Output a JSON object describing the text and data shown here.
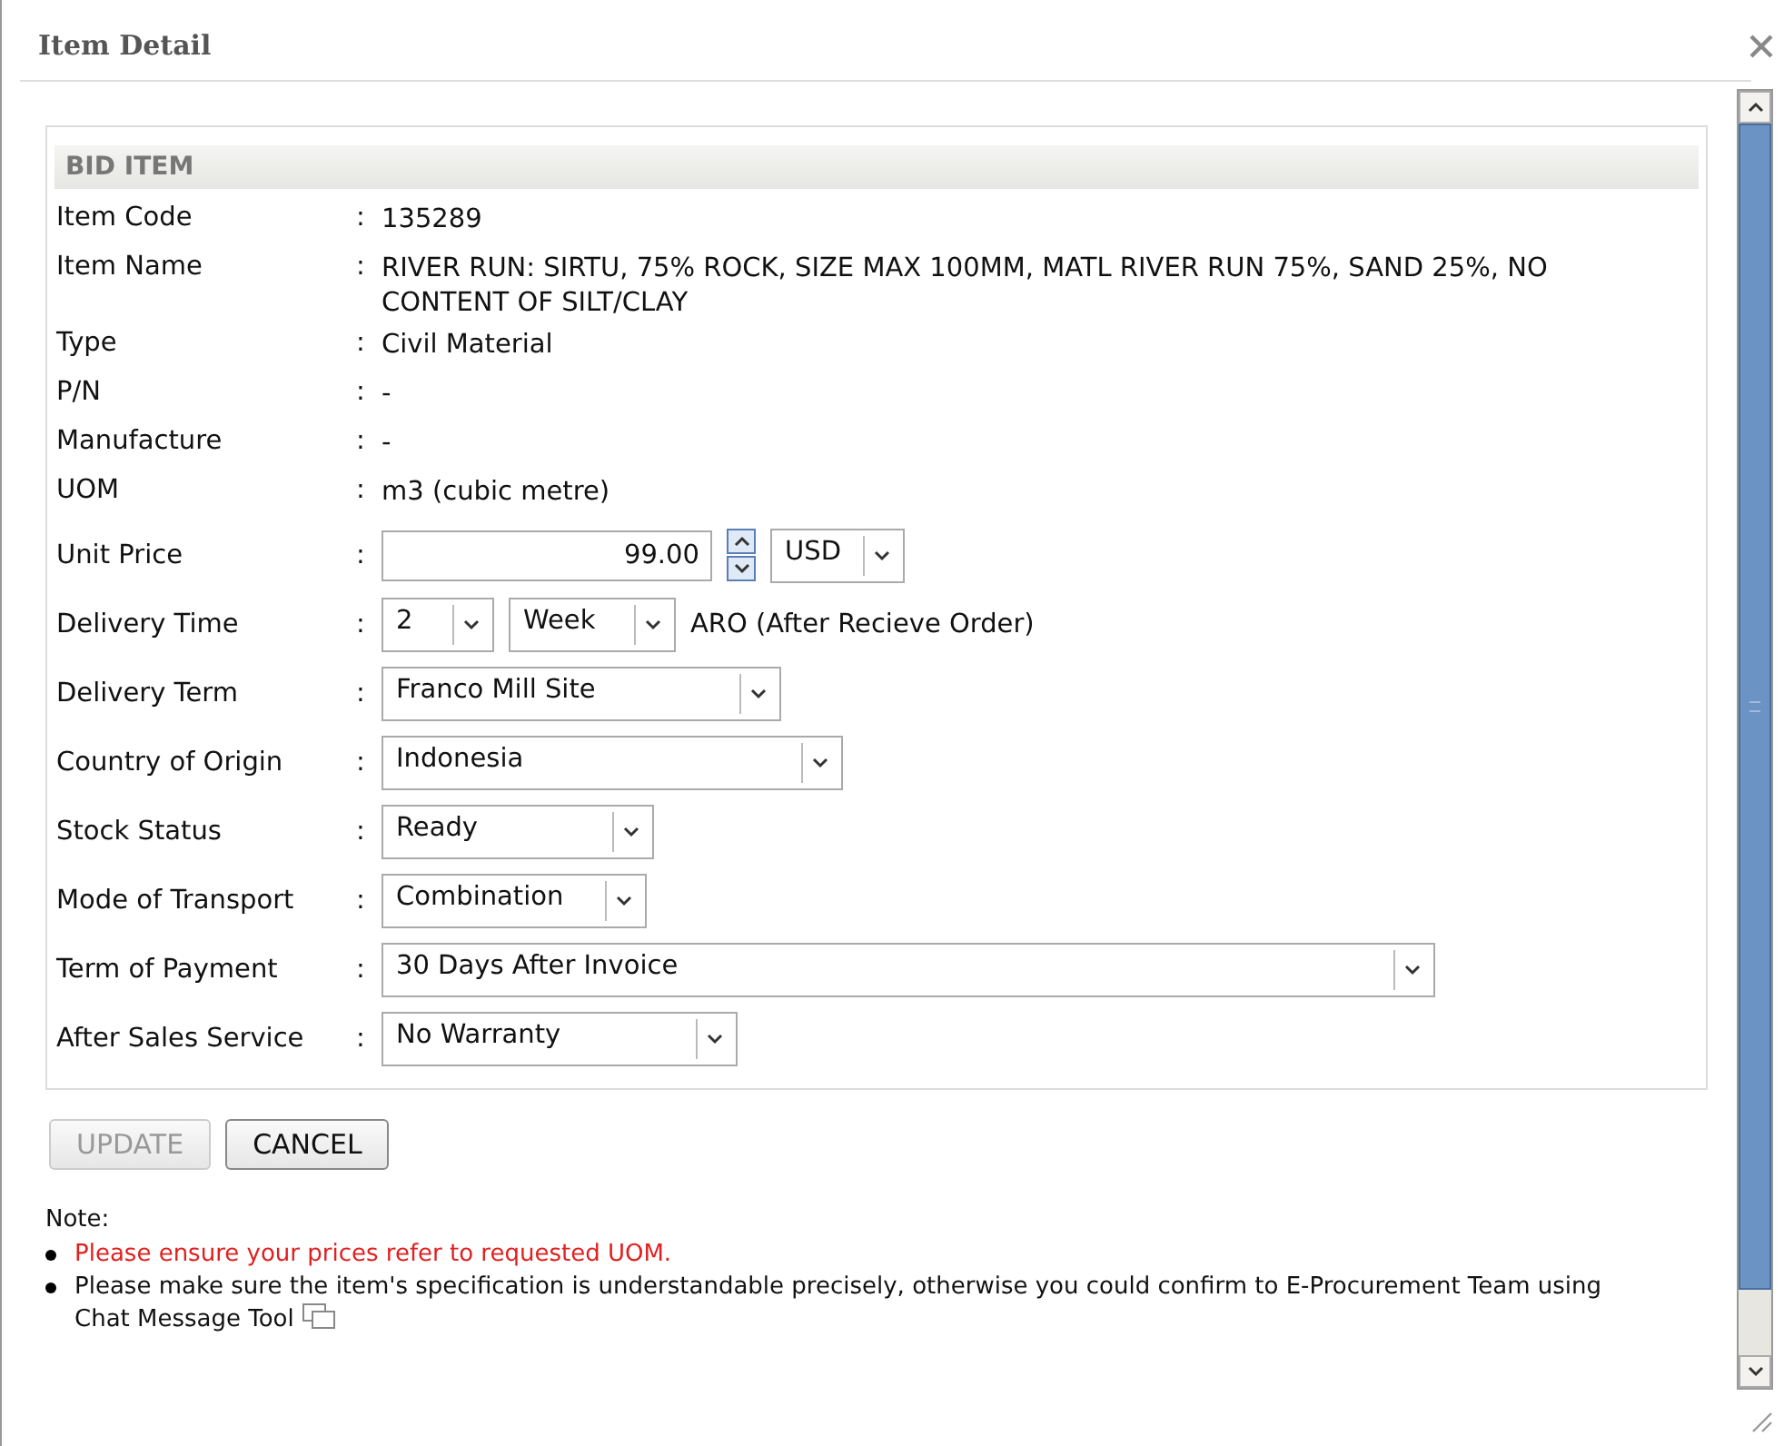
{
  "dialog": {
    "title": "Item Detail"
  },
  "section": {
    "title": "BID ITEM",
    "fields": [
      {
        "kind": "text",
        "label": "Item Code",
        "colon": ":",
        "value": "135289"
      },
      {
        "kind": "text",
        "label": "Item Name",
        "colon": ":",
        "value": "RIVER RUN: SIRTU, 75% ROCK, SIZE MAX 100MM, MATL RIVER RUN 75%, SAND 25%, NO CONTENT OF SILT/CLAY"
      },
      {
        "kind": "text",
        "label": "Type",
        "colon": ":",
        "value": "Civil Material"
      },
      {
        "kind": "text",
        "label": "P/N",
        "colon": ":",
        "value": "-"
      },
      {
        "kind": "text",
        "label": "Manufacture",
        "colon": ":",
        "value": "-"
      },
      {
        "kind": "text",
        "label": "UOM",
        "colon": ":",
        "value": "m3 (cubic metre)"
      },
      {
        "kind": "price",
        "label": "Unit Price",
        "colon": ":",
        "value": "99.00",
        "currency": "USD"
      },
      {
        "kind": "delivery",
        "label": "Delivery Time",
        "colon": ":",
        "amount": "2",
        "unit": "Week",
        "note": "ARO (After Recieve Order)"
      },
      {
        "kind": "select",
        "label": "Delivery Term",
        "colon": ":",
        "value": "Franco Mill Site"
      },
      {
        "kind": "select",
        "label": "Country of Origin",
        "colon": ":",
        "value": "Indonesia"
      },
      {
        "kind": "select",
        "label": "Stock Status",
        "colon": ":",
        "value": "Ready"
      },
      {
        "kind": "select",
        "label": "Mode of Transport",
        "colon": ":",
        "value": "Combination"
      },
      {
        "kind": "select",
        "label": "Term of Payment",
        "colon": ":",
        "value": "30 Days After Invoice"
      },
      {
        "kind": "select",
        "label": "After Sales Service",
        "colon": ":",
        "value": "No Warranty"
      }
    ]
  },
  "buttons": [
    {
      "label": "UPDATE",
      "disabled": true
    },
    {
      "label": "CANCEL",
      "disabled": false
    }
  ],
  "note": {
    "title": "Note:",
    "items": [
      {
        "kind": "warning",
        "text": "Please ensure your prices refer to requested UOM."
      },
      {
        "kind": "info",
        "text": "Please make sure the item's specification is understandable precisely, otherwise you could confirm to E-Procurement Team using Chat Message Tool",
        "icon": true
      }
    ]
  }
}
